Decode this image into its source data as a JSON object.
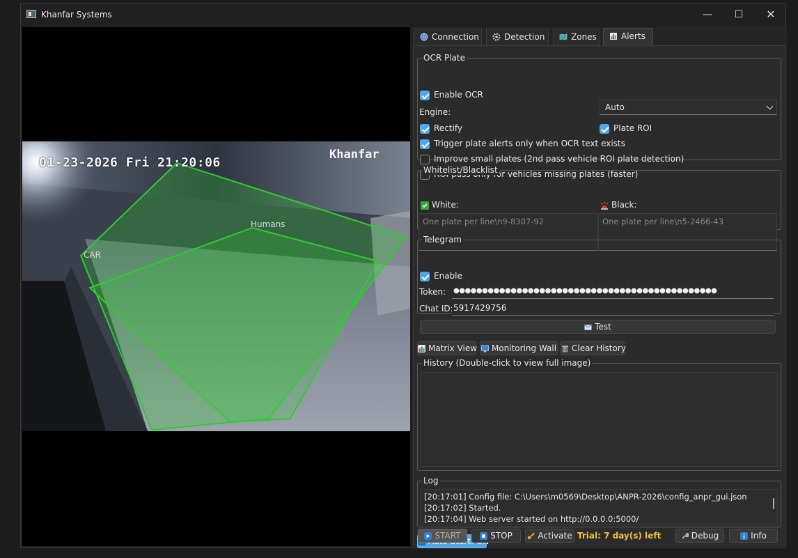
{
  "window": {
    "title": "Khanfar Systems"
  },
  "video": {
    "timestamp": "01-23-2026 Fri 21:20:06",
    "brand": "Khanfar",
    "zones": [
      "CAR",
      "Humans"
    ],
    "zone_color": "#2fcc2f"
  },
  "tabs": [
    {
      "label": "Connection",
      "icon": "globe-icon"
    },
    {
      "label": "Detection",
      "icon": "gear-icon"
    },
    {
      "label": "Zones",
      "icon": "map-icon"
    },
    {
      "label": "Alerts",
      "icon": "chart-icon",
      "active": true
    }
  ],
  "ocr": {
    "title": "OCR  Plate",
    "enable_ocr": {
      "label": "Enable OCR",
      "checked": true
    },
    "engine_label": "Engine:",
    "engine_value": "Auto",
    "rectify": {
      "label": "Rectify",
      "checked": true
    },
    "plate_roi": {
      "label": "Plate ROI",
      "checked": true
    },
    "trigger_only": {
      "label": "Trigger plate alerts only when OCR text exists",
      "checked": true
    },
    "improve_small": {
      "label": "Improve small plates (2nd pass vehicle ROI plate detection)",
      "checked": false
    },
    "roi_only_missing": {
      "label": "ROI pass only for vehicles missing plates (faster)",
      "checked": false
    }
  },
  "lists": {
    "title": "Whitelist/Blacklist",
    "white_label": "White:",
    "white_placeholder": "One plate per line\\n9-8307-92",
    "black_label": "Black:",
    "black_placeholder": "One plate per line\\n5-2466-43"
  },
  "telegram": {
    "title": "Telegram",
    "enable": {
      "label": "Enable",
      "checked": true
    },
    "token_label": "Token:",
    "token_value": "●●●●●●●●●●●●●●●●●●●●●●●●●●●●●●●●●●●●●●●●●●●●●●",
    "chat_label": "Chat ID:",
    "chat_value": "5917429756",
    "test_button": "Test"
  },
  "views": {
    "matrix": "Matrix View",
    "wall": "Monitoring Wall",
    "clear": "Clear History"
  },
  "history": {
    "title": "History (Double-click to view full image)"
  },
  "log": {
    "title": "Log",
    "lines": [
      "[20:17:01] Config file: C:\\Users\\m0569\\Desktop\\ANPR-2026\\config_anpr_gui.json",
      "[20:17:02] Started.",
      "[20:17:04] Web server started on http://0.0.0.0:5000/"
    ]
  },
  "footer": {
    "auto_start": "Auto Start: ON",
    "start": "START",
    "stop": "STOP",
    "activate": "Activate",
    "trial": "Trial: 7 day(s) left",
    "debug": "Debug",
    "info": "Info",
    "trial_color": "#f0c040",
    "accent": "#52a7e8"
  }
}
